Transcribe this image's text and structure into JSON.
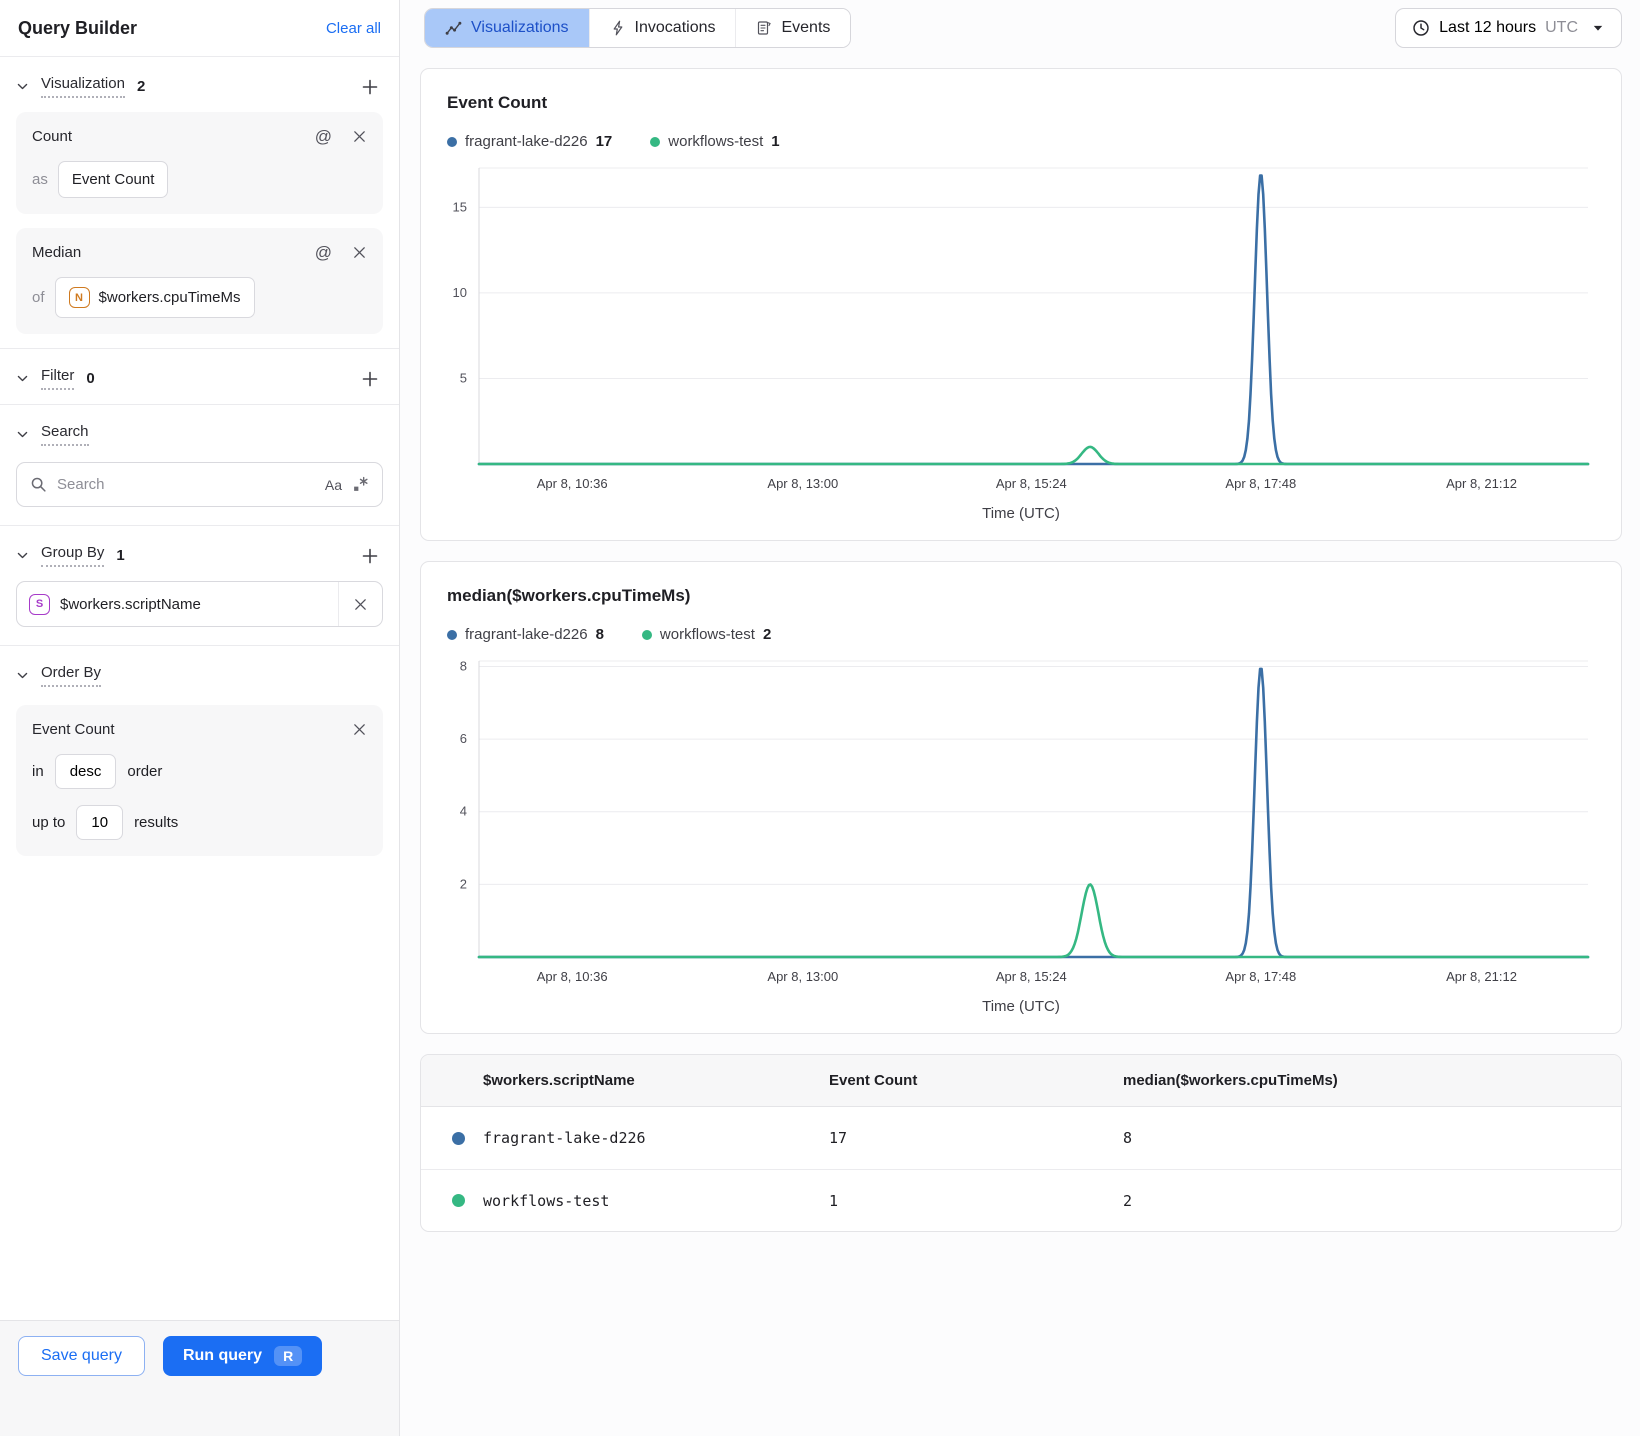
{
  "sidebar": {
    "title": "Query Builder",
    "clear_all_label": "Clear all",
    "visualization_section": {
      "label": "Visualization",
      "count": "2"
    },
    "count_card": {
      "title": "Count",
      "prefix": "as",
      "value": "Event Count"
    },
    "median_card": {
      "title": "Median",
      "prefix": "of",
      "badge": "N",
      "value": "$workers.cpuTimeMs"
    },
    "filter_section": {
      "label": "Filter",
      "count": "0"
    },
    "search_section": {
      "label": "Search",
      "placeholder": "Search",
      "match_case_label": "Aa"
    },
    "group_by_section": {
      "label": "Group By",
      "count": "1",
      "item": {
        "badge": "S",
        "value": "$workers.scriptName"
      }
    },
    "order_by_section": {
      "label": "Order By",
      "card": {
        "title": "Event Count",
        "in_label": "in",
        "direction": "desc",
        "order_label": "order",
        "up_to_label": "up to",
        "limit": "10",
        "results_label": "results"
      }
    },
    "footer": {
      "save_label": "Save query",
      "run_label": "Run query",
      "run_shortcut": "R"
    }
  },
  "header": {
    "tabs": [
      {
        "label": "Visualizations",
        "active": true
      },
      {
        "label": "Invocations",
        "active": false
      },
      {
        "label": "Events",
        "active": false
      }
    ],
    "time_range": {
      "label": "Last 12 hours",
      "timezone": "UTC"
    }
  },
  "chart_data": [
    {
      "type": "line",
      "title": "Event Count",
      "xlabel": "Time (UTC)",
      "ylabel": "",
      "ylim": [
        0,
        17.3
      ],
      "yticks": [
        5,
        10,
        15
      ],
      "grid": true,
      "legend_position": "top",
      "x_ticks": [
        {
          "label": "Apr 8, 10:36",
          "pos": 0.084
        },
        {
          "label": "Apr 8, 13:00",
          "pos": 0.292
        },
        {
          "label": "Apr 8, 15:24",
          "pos": 0.498
        },
        {
          "label": "Apr 8, 17:48",
          "pos": 0.705
        },
        {
          "label": "Apr 8, 21:12",
          "pos": 0.904
        }
      ],
      "series": [
        {
          "name": "fragrant-lake-d226",
          "color": "#3b6fa5",
          "legend_value": "17",
          "baseline": 0,
          "peaks": [
            {
              "center": 0.705,
              "sigma": 0.0055,
              "value": 17
            }
          ]
        },
        {
          "name": "workflows-test",
          "color": "#35b883",
          "legend_value": "1",
          "baseline": 0,
          "peaks": [
            {
              "center": 0.551,
              "sigma": 0.0075,
              "value": 1
            }
          ]
        }
      ]
    },
    {
      "type": "line",
      "title": "median($workers.cpuTimeMs)",
      "xlabel": "Time (UTC)",
      "ylabel": "",
      "ylim": [
        0,
        8.15
      ],
      "yticks": [
        2,
        4,
        6,
        8
      ],
      "grid": true,
      "legend_position": "top",
      "x_ticks": [
        {
          "label": "Apr 8, 10:36",
          "pos": 0.084
        },
        {
          "label": "Apr 8, 13:00",
          "pos": 0.292
        },
        {
          "label": "Apr 8, 15:24",
          "pos": 0.498
        },
        {
          "label": "Apr 8, 17:48",
          "pos": 0.705
        },
        {
          "label": "Apr 8, 21:12",
          "pos": 0.904
        }
      ],
      "series": [
        {
          "name": "fragrant-lake-d226",
          "color": "#3b6fa5",
          "legend_value": "8",
          "baseline": 0,
          "peaks": [
            {
              "center": 0.705,
              "sigma": 0.0055,
              "value": 8
            }
          ]
        },
        {
          "name": "workflows-test",
          "color": "#35b883",
          "legend_value": "2",
          "baseline": 0,
          "peaks": [
            {
              "center": 0.551,
              "sigma": 0.0075,
              "value": 2
            }
          ]
        }
      ]
    }
  ],
  "table": {
    "headers": [
      "$workers.scriptName",
      "Event Count",
      "median($workers.cpuTimeMs)"
    ],
    "rows": [
      {
        "color": "#3b6fa5",
        "name": "fragrant-lake-d226",
        "event_count": "17",
        "median": "8"
      },
      {
        "color": "#35b883",
        "name": "workflows-test",
        "event_count": "1",
        "median": "2"
      }
    ]
  },
  "colors": {
    "accent": "#1b6ef3",
    "series_blue": "#3b6fa5",
    "series_green": "#35b883",
    "tab_active_bg": "#a9c8f8"
  }
}
